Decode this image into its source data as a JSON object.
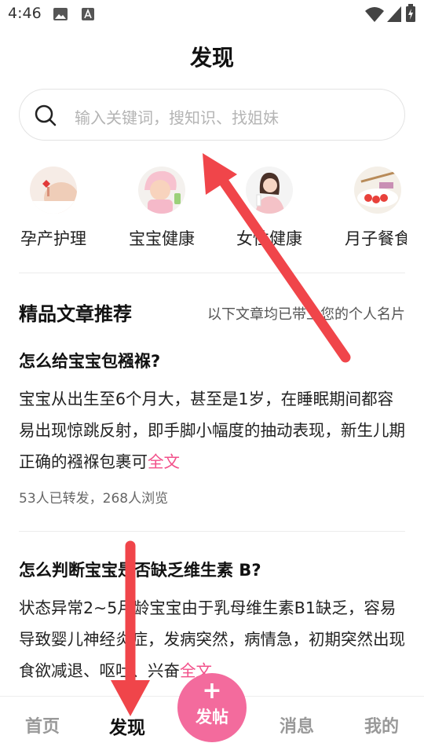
{
  "status_bar": {
    "time": "4:46"
  },
  "header": {
    "title": "发现"
  },
  "search": {
    "placeholder": "输入关键词，搜知识、找姐妹"
  },
  "categories": [
    {
      "label": "孕产护理"
    },
    {
      "label": "宝宝健康"
    },
    {
      "label": "女性健康"
    },
    {
      "label": "月子餐食"
    }
  ],
  "section": {
    "title": "精品文章推荐",
    "note": "以下文章均已带上您的个人名片"
  },
  "articles": [
    {
      "title": "怎么给宝宝包襁褓?",
      "body": "宝宝从出生至6个月大，甚至是1岁，在睡眠期间都容易出现惊跳反射，即手脚小幅度的抽动表现，新生儿期正确的襁褓包裹可",
      "more": "全文",
      "meta": "53人已转发，268人浏览"
    },
    {
      "title": "怎么判断宝宝是否缺乏维生素 B?",
      "body": "状态异常2~5月龄宝宝由于乳母维生素B1缺乏，容易导致婴儿神经炎症，发病突然，病情急，初期突然出现食欲减退、呕吐、兴奋",
      "more": "全文"
    }
  ],
  "tabbar": {
    "home": "首页",
    "discover": "发现",
    "post_plus": "+",
    "post": "发帖",
    "messages": "消息",
    "mine": "我的"
  },
  "colors": {
    "accent": "#f36b9d",
    "link": "#f2508a",
    "annotation_arrow": "#f0454a"
  }
}
